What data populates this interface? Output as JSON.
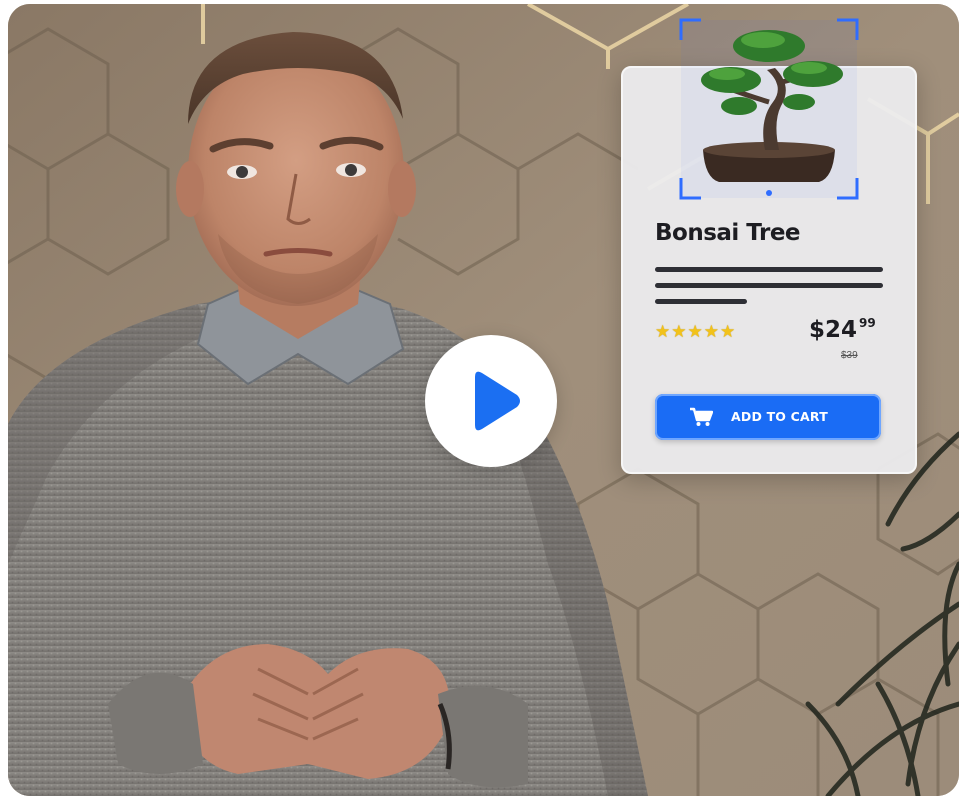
{
  "video": {
    "play_label": "Play video"
  },
  "product": {
    "title": "Bonsai Tree",
    "rating_stars": "★★★★★",
    "rating": 5,
    "price_dollars": "$24",
    "price_cents": "99",
    "old_price": "$39",
    "add_to_cart_label": "ADD TO CART"
  },
  "colors": {
    "accent": "#1a6cf5",
    "star": "#f2c21a",
    "card_bg": "#ececee",
    "wall": "#9a8a77",
    "hex_line": "#e4cf9f"
  },
  "icons": {
    "play": "play-icon",
    "cart": "cart-icon",
    "stars": "star-icon"
  }
}
